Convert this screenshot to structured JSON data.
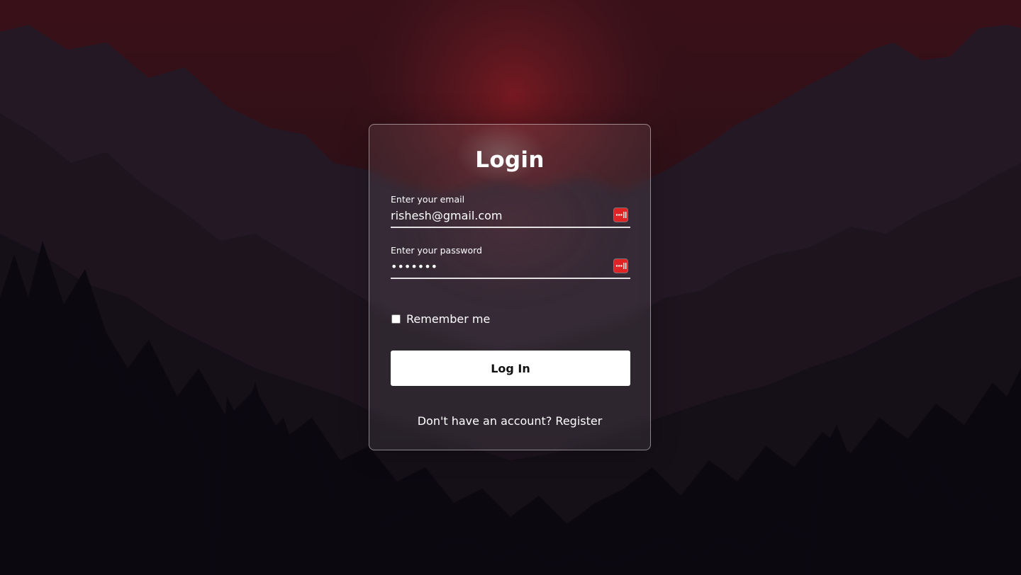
{
  "login_form": {
    "title": "Login",
    "email": {
      "label": "Enter your email",
      "value": "rishesh@gmail.com"
    },
    "password": {
      "label": "Enter your password",
      "masked_value": "•••••••"
    },
    "remember": {
      "label": "Remember me",
      "checked": false
    },
    "submit_label": "Log In",
    "register_prompt": "Don't have an account?",
    "register_link": "Register"
  },
  "icons": {
    "password_manager": "password-manager-icon"
  },
  "colors": {
    "card_border": "#ffffff",
    "button_bg": "#ffffff",
    "button_text": "#111111",
    "password_manager_icon": "#e02424",
    "sky_top": "#3a1018",
    "sun_glow": "#7a1a22"
  }
}
